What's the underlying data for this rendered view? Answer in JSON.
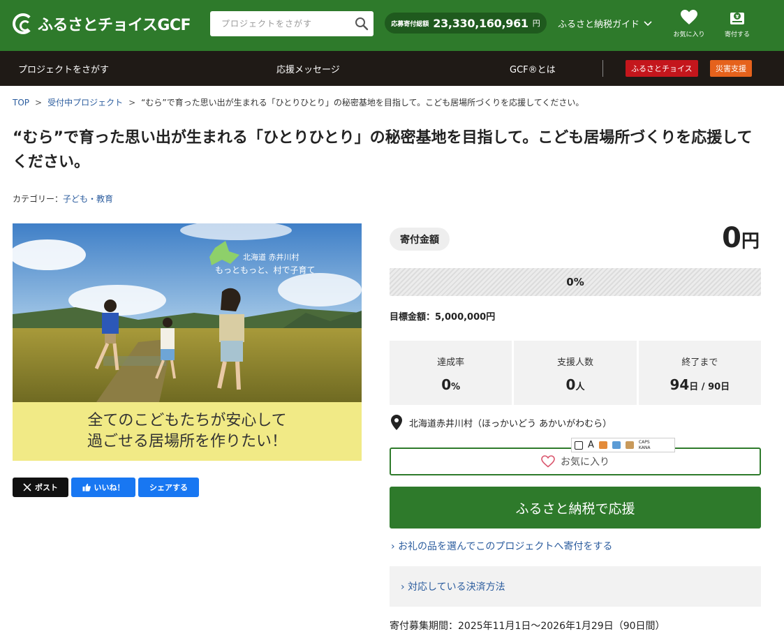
{
  "header": {
    "logo_text": "ふるさとチョイスGCF",
    "search_placeholder": "プロジェクトをさがす",
    "total_label": "応募寄付総額",
    "total_value": "23,330,160,961",
    "total_unit": "円",
    "guide_label": "ふるさと納税ガイド",
    "favorites_label": "お気に入り",
    "donate_label": "寄付する"
  },
  "nav": {
    "items": [
      "プロジェクトをさがす",
      "応援メッセージ",
      "GCF®とは"
    ],
    "badge_choice": "ふるさとチョイス",
    "badge_disaster": "災害支援",
    "colors": {
      "choice": "#c4161c",
      "disaster": "#e5621c"
    }
  },
  "breadcrumb": {
    "home": "TOP",
    "parent": "受付中プロジェクト",
    "current": "“むら”で育った思い出が生まれる「ひとりひとり」の秘密基地を目指して。こども居場所づくりを応援してください。"
  },
  "page": {
    "title": "“むら”で育った思い出が生まれる「ひとりひとり」の秘密基地を目指して。こども居場所づくりを応援してください。",
    "category_label": "カテゴリー：",
    "category_value": "子ども・教育"
  },
  "hero": {
    "place": "北海道 赤井川村",
    "slogan": "もっともっと、村で子育て",
    "caption_line1": "全てのこどもたちが安心して",
    "caption_line2": "過ごせる居場所を作りたい！"
  },
  "social": {
    "post": "ポスト",
    "like": "いいね！",
    "share": "シェアする"
  },
  "funding": {
    "label": "寄付金額",
    "amount": "0",
    "amount_unit": "円",
    "progress_fraction": 0,
    "progress_text": "0%",
    "target": "目標金額：5,000,000円",
    "stats": [
      {
        "label": "達成率",
        "value": "0",
        "unit": "%"
      },
      {
        "label": "支援人数",
        "value": "0",
        "unit": "人"
      },
      {
        "label": "終了まで",
        "value": "94",
        "unit": "日 / 90日"
      }
    ],
    "location": "北海道赤井川村（ほっかいどう あかいがわむら）",
    "ime_caps": "CAPS",
    "ime_kana": "KANA",
    "favorite_button": "お気に入り",
    "donate_button": "ふるさと納税で応援",
    "gift_link": "お礼の品を選んでこのプロジェクトへ寄付をする",
    "payment_link": "対応している決済方法",
    "period": "寄付募集期間：2025年11月1日〜2026年1月29日（90日間）"
  },
  "colors": {
    "brand_green": "#2e7a2b",
    "nav_dark": "#1f1a16",
    "link_blue": "#2b5c9e",
    "social_x": "#111111",
    "social_facebook": "#1877f2"
  }
}
